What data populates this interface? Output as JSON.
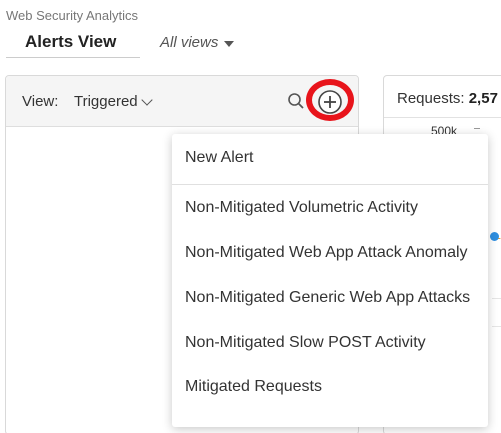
{
  "header": {
    "app_title": "Web Security Analytics",
    "view_tab": "Alerts View",
    "all_views": "All views"
  },
  "left_panel": {
    "view_label": "View:",
    "view_value": "Triggered",
    "icons": [
      "search-icon",
      "add-circle-icon",
      "chevron-down-icon"
    ]
  },
  "right_panel": {
    "requests_label": "Requests:",
    "requests_value": "2,57",
    "axis_tick": "500k"
  },
  "menu": {
    "items": [
      "New Alert",
      "Non-Mitigated Volumetric Activity",
      "Non-Mitigated Web App Attack Anomaly",
      "Non-Mitigated Generic Web App Attacks",
      "Non-Mitigated Slow POST Activity",
      "Mitigated Requests"
    ]
  },
  "colors": {
    "highlight": "#e8141b",
    "data_point": "#2f8fe0",
    "threshold_line": "#f0a030"
  }
}
